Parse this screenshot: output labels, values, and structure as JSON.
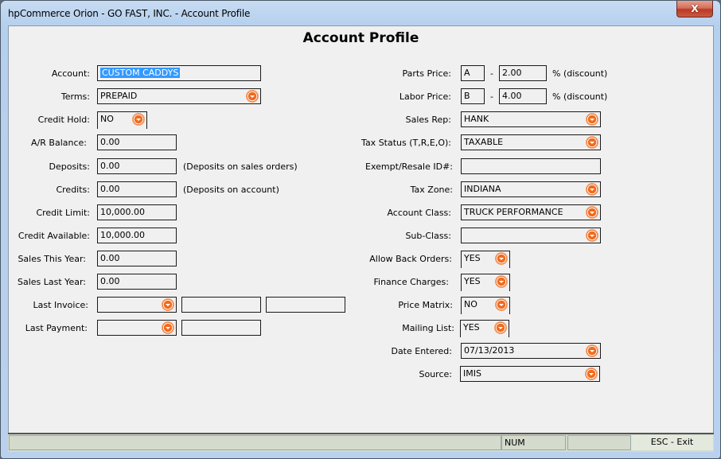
{
  "window": {
    "title": "hpCommerce Orion - GO FAST, INC. - Account Profile",
    "close_label": "X"
  },
  "page": {
    "title": "Account Profile"
  },
  "left": {
    "account": {
      "label": "Account:",
      "value": "CUSTOM CADDYS"
    },
    "terms": {
      "label": "Terms:",
      "value": "PREPAID"
    },
    "credit_hold": {
      "label": "Credit Hold:",
      "value": "NO"
    },
    "ar_balance": {
      "label": "A/R Balance:",
      "value": "0.00"
    },
    "deposits": {
      "label": "Deposits:",
      "value": "0.00",
      "note": "(Deposits on sales orders)"
    },
    "credits": {
      "label": "Credits:",
      "value": "0.00",
      "note": "(Deposits on account)"
    },
    "credit_limit": {
      "label": "Credit Limit:",
      "value": "10,000.00"
    },
    "credit_available": {
      "label": "Credit Available:",
      "value": "10,000.00"
    },
    "sales_this_year": {
      "label": "Sales This Year:",
      "value": "0.00"
    },
    "sales_last_year": {
      "label": "Sales Last Year:",
      "value": "0.00"
    },
    "last_invoice": {
      "label": "Last Invoice:",
      "value": "",
      "field2": "",
      "field3": ""
    },
    "last_payment": {
      "label": "Last Payment:",
      "value": "",
      "field2": ""
    }
  },
  "right": {
    "parts_price": {
      "label": "Parts Price:",
      "level": "A",
      "dash": "-",
      "percent": "2.00",
      "suffix": "% (discount)"
    },
    "labor_price": {
      "label": "Labor Price:",
      "level": "B",
      "dash": "-",
      "percent": "4.00",
      "suffix": "% (discount)"
    },
    "sales_rep": {
      "label": "Sales Rep:",
      "value": "HANK"
    },
    "tax_status": {
      "label": "Tax Status (T,R,E,O):",
      "value": "TAXABLE"
    },
    "exempt_id": {
      "label": "Exempt/Resale ID#:",
      "value": ""
    },
    "tax_zone": {
      "label": "Tax Zone:",
      "value": "INDIANA"
    },
    "account_class": {
      "label": "Account Class:",
      "value": "TRUCK PERFORMANCE"
    },
    "sub_class": {
      "label": "Sub-Class:",
      "value": ""
    },
    "allow_back_orders": {
      "label": "Allow Back Orders:",
      "value": "YES"
    },
    "finance_charges": {
      "label": "Finance Charges:",
      "value": "YES"
    },
    "price_matrix": {
      "label": "Price Matrix:",
      "value": "NO"
    },
    "mailing_list": {
      "label": "Mailing List:",
      "value": "YES"
    },
    "date_entered": {
      "label": "Date Entered:",
      "value": "07/13/2013"
    },
    "source": {
      "label": "Source:",
      "value": "IMIS"
    }
  },
  "statusbar": {
    "message": "",
    "num": "NUM",
    "blank": "",
    "exit": "ESC - Exit"
  }
}
